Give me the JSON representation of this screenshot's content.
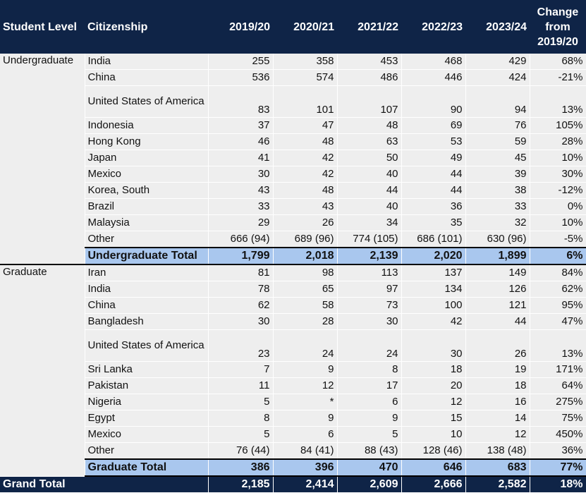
{
  "headers": {
    "student_level": "Student Level",
    "citizenship": "Citizenship",
    "y1": "2019/20",
    "y2": "2020/21",
    "y3": "2021/22",
    "y4": "2022/23",
    "y5": "2023/24",
    "change_l1": "Change",
    "change_l2": "from",
    "change_l3": "2019/20"
  },
  "undergrad": {
    "level": "Undergraduate",
    "rows": [
      {
        "c": "India",
        "v": [
          "255",
          "358",
          "453",
          "468",
          "429"
        ],
        "ch": "68%"
      },
      {
        "c": "China",
        "v": [
          "536",
          "574",
          "486",
          "446",
          "424"
        ],
        "ch": "-21%"
      },
      {
        "c": "United States of America",
        "v": [
          "83",
          "101",
          "107",
          "90",
          "94"
        ],
        "ch": "13%"
      },
      {
        "c": "Indonesia",
        "v": [
          "37",
          "47",
          "48",
          "69",
          "76"
        ],
        "ch": "105%"
      },
      {
        "c": "Hong Kong",
        "v": [
          "46",
          "48",
          "63",
          "53",
          "59"
        ],
        "ch": "28%"
      },
      {
        "c": "Japan",
        "v": [
          "41",
          "42",
          "50",
          "49",
          "45"
        ],
        "ch": "10%"
      },
      {
        "c": "Mexico",
        "v": [
          "30",
          "42",
          "40",
          "44",
          "39"
        ],
        "ch": "30%"
      },
      {
        "c": "Korea, South",
        "v": [
          "43",
          "48",
          "44",
          "44",
          "38"
        ],
        "ch": "-12%"
      },
      {
        "c": "Brazil",
        "v": [
          "33",
          "43",
          "40",
          "36",
          "33"
        ],
        "ch": "0%"
      },
      {
        "c": "Malaysia",
        "v": [
          "29",
          "26",
          "34",
          "35",
          "32"
        ],
        "ch": "10%"
      },
      {
        "c": "Other",
        "v": [
          "666 (94)",
          "689 (96)",
          "774 (105)",
          "686 (101)",
          "630 (96)"
        ],
        "ch": "-5%"
      }
    ],
    "total": {
      "c": "Undergraduate Total",
      "v": [
        "1,799",
        "2,018",
        "2,139",
        "2,020",
        "1,899"
      ],
      "ch": "6%"
    }
  },
  "grad": {
    "level": "Graduate",
    "rows": [
      {
        "c": "Iran",
        "v": [
          "81",
          "98",
          "113",
          "137",
          "149"
        ],
        "ch": "84%"
      },
      {
        "c": "India",
        "v": [
          "78",
          "65",
          "97",
          "134",
          "126"
        ],
        "ch": "62%"
      },
      {
        "c": "China",
        "v": [
          "62",
          "58",
          "73",
          "100",
          "121"
        ],
        "ch": "95%"
      },
      {
        "c": "Bangladesh",
        "v": [
          "30",
          "28",
          "30",
          "42",
          "44"
        ],
        "ch": "47%"
      },
      {
        "c": "United States of America",
        "v": [
          "23",
          "24",
          "24",
          "30",
          "26"
        ],
        "ch": "13%"
      },
      {
        "c": "Sri Lanka",
        "v": [
          "7",
          "9",
          "8",
          "18",
          "19"
        ],
        "ch": "171%"
      },
      {
        "c": "Pakistan",
        "v": [
          "11",
          "12",
          "17",
          "20",
          "18"
        ],
        "ch": "64%"
      },
      {
        "c": "Nigeria",
        "v": [
          "5",
          "*",
          "6",
          "12",
          "16"
        ],
        "ch": "275%"
      },
      {
        "c": "Egypt",
        "v": [
          "8",
          "9",
          "9",
          "15",
          "14"
        ],
        "ch": "75%"
      },
      {
        "c": "Mexico",
        "v": [
          "5",
          "6",
          "5",
          "10",
          "12"
        ],
        "ch": "450%"
      },
      {
        "c": "Other",
        "v": [
          "76 (44)",
          "84 (41)",
          "88 (43)",
          "128 (46)",
          "138 (48)"
        ],
        "ch": "36%"
      }
    ],
    "total": {
      "c": "Graduate Total",
      "v": [
        "386",
        "396",
        "470",
        "646",
        "683"
      ],
      "ch": "77%"
    }
  },
  "grand": {
    "label": "Grand Total",
    "v": [
      "2,185",
      "2,414",
      "2,609",
      "2,666",
      "2,582"
    ],
    "ch": "18%"
  }
}
